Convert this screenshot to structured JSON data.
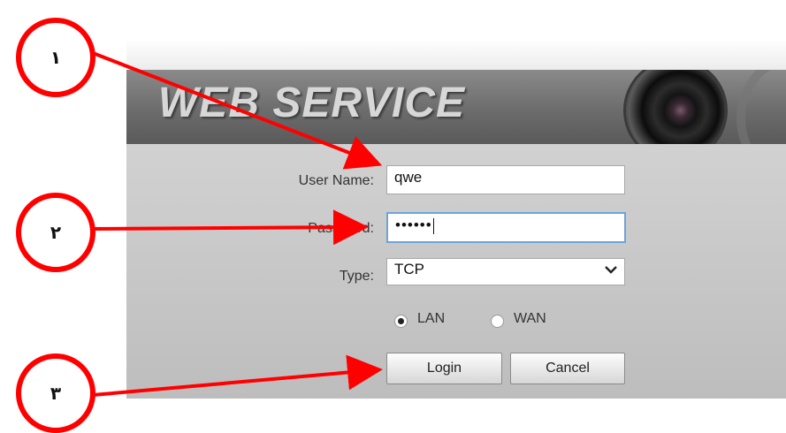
{
  "banner": {
    "title": "WEB SERVICE"
  },
  "form": {
    "username_label": "User Name:",
    "username_value": "qwe",
    "password_label": "Password:",
    "password_value": "••••••",
    "type_label": "Type:",
    "type_value": "TCP",
    "network": {
      "lan_label": "LAN",
      "wan_label": "WAN",
      "selected": "LAN"
    },
    "login_label": "Login",
    "cancel_label": "Cancel"
  },
  "annotations": {
    "badges": [
      {
        "label": "١"
      },
      {
        "label": "٢"
      },
      {
        "label": "٣"
      }
    ],
    "color": "#ff0000"
  },
  "icons": {
    "select": "chevron-down-icon"
  }
}
